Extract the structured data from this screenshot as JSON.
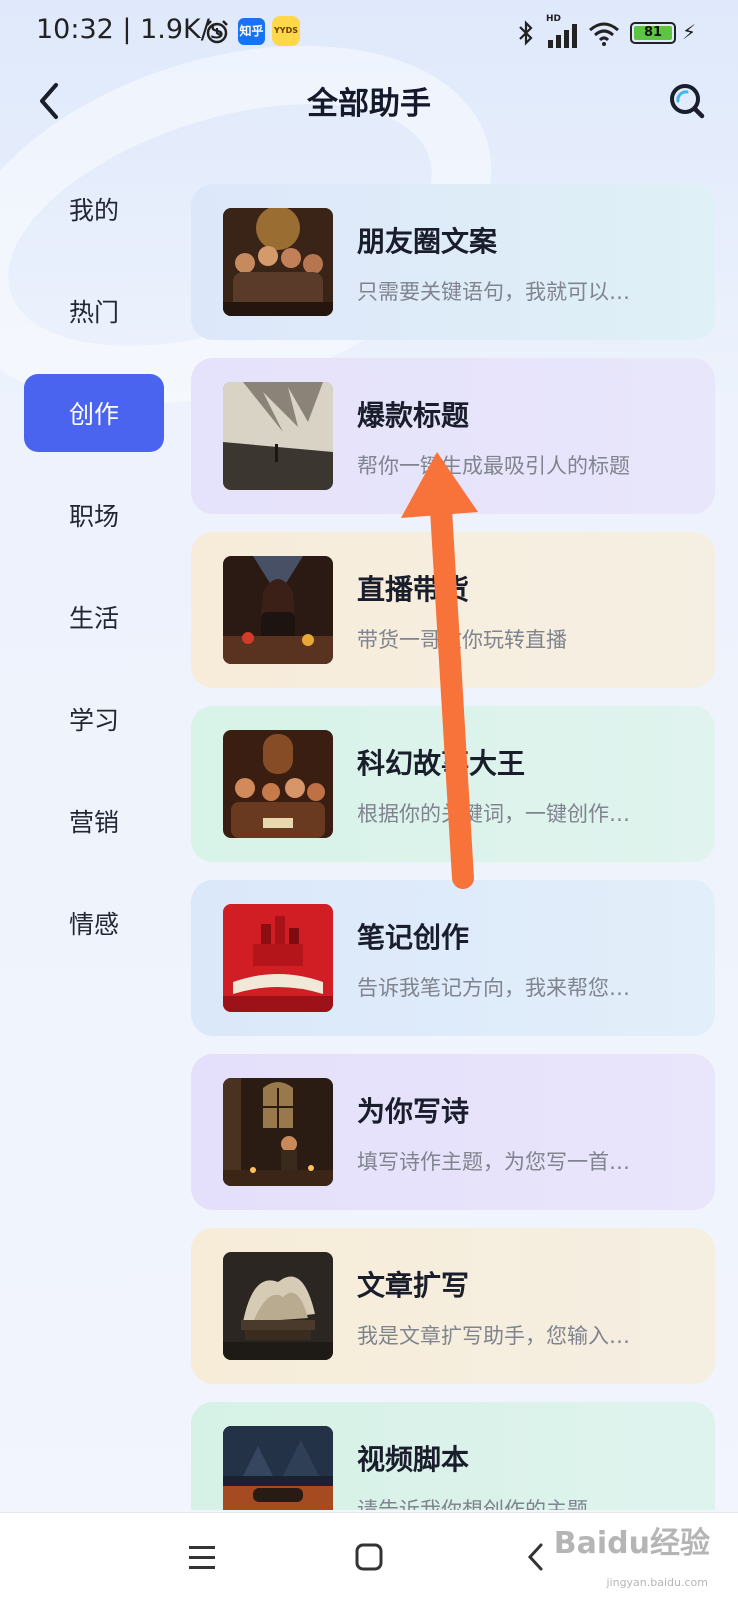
{
  "status_bar": {
    "time_speed": "10:32 | 1.9K/s",
    "zhihu_badge": "知乎",
    "app_badge": "YYDS",
    "network_type": "HD",
    "battery_level": "81"
  },
  "header": {
    "title": "全部助手"
  },
  "sidebar": {
    "items": [
      {
        "label": "我的"
      },
      {
        "label": "热门"
      },
      {
        "label": "创作"
      },
      {
        "label": "职场"
      },
      {
        "label": "生活"
      },
      {
        "label": "学习"
      },
      {
        "label": "营销"
      },
      {
        "label": "情感"
      }
    ],
    "active_index": 2
  },
  "assistants": [
    {
      "name": "朋友圈文案",
      "desc": "只需要关键语句，我就可以…"
    },
    {
      "name": "爆款标题",
      "desc": "帮你一键生成最吸引人的标题"
    },
    {
      "name": "直播带货",
      "desc": "带货一哥教你玩转直播"
    },
    {
      "name": "科幻故事大王",
      "desc": "根据你的关键词，一键创作…"
    },
    {
      "name": "笔记创作",
      "desc": "告诉我笔记方向，我来帮您…"
    },
    {
      "name": "为你写诗",
      "desc": "填写诗作主题，为您写一首…"
    },
    {
      "name": "文章扩写",
      "desc": "我是文章扩写助手，您输入…"
    },
    {
      "name": "视频脚本",
      "desc": "请告诉我你想创作的主题"
    }
  ],
  "watermark": {
    "text": "Baidu经验",
    "sub": "jingyan.baidu.com"
  },
  "colors": {
    "accent": "#4a64f0",
    "arrow": "#f7733a"
  }
}
